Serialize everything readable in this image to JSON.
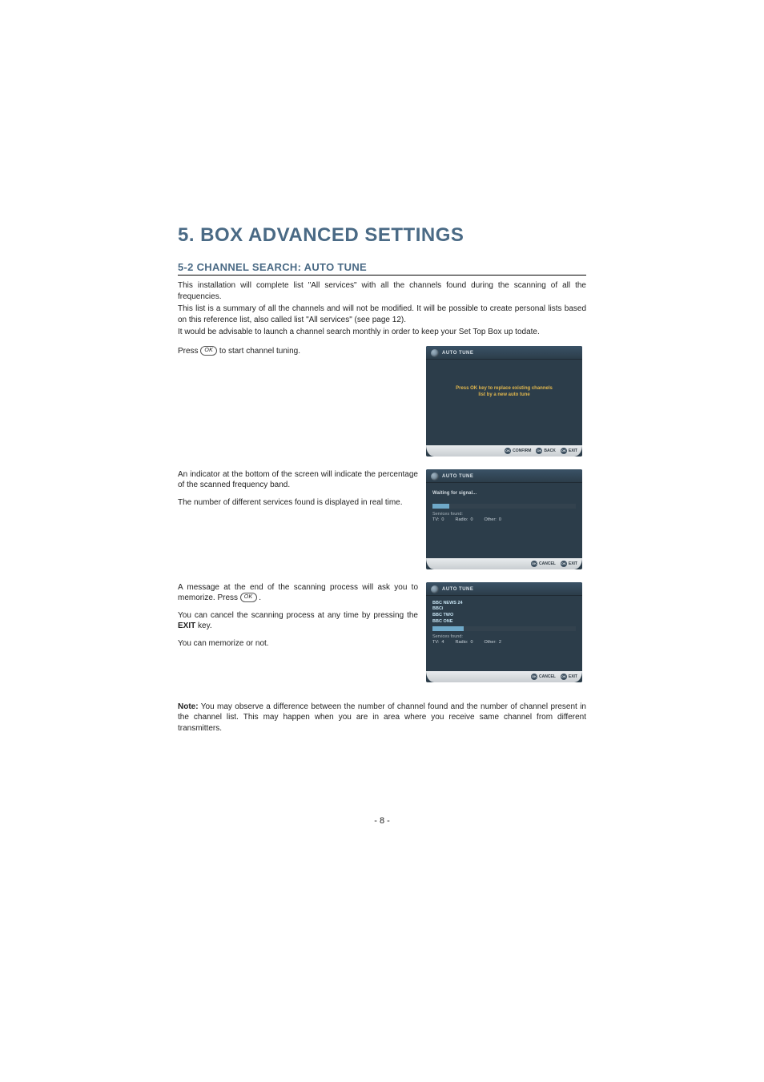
{
  "page": {
    "title": "5. BOX ADVANCED SETTINGS",
    "subsection": "5-2 CHANNEL SEARCH: AUTO TUNE",
    "intro": [
      "This installation will complete list \"All services\" with all the channels found during the scanning of all the frequencies.",
      "This list is a summary of all the channels and will not be modified. It will be possible to create personal lists based on this reference list, also called list \"All services\" (see page 12).",
      "It would be advisable to launch a channel search monthly in order to keep your Set Top Box up todate."
    ],
    "press": {
      "pre": "Press",
      "ok": "OK",
      "post": "to start channel tuning."
    },
    "mid_left": [
      "An indicator at the bottom of the screen will indicate the percentage of the scanned frequency band.",
      "The number of different services found is displayed in real time."
    ],
    "end_left": {
      "p1_pre": "A message at the end of the scanning process will ask you to memorize. Press",
      "p1_ok": "OK",
      "p1_post": ".",
      "p2_pre": "You can cancel the scanning process at any time by pressing the ",
      "p2_bold": "EXIT",
      "p2_post": " key.",
      "p3": "You can memorize or not."
    },
    "note": {
      "label": "Note:",
      "text": " You may observe a difference between the number of channel found and the number of channel present in the channel list. This may happen when you are in area where you receive same channel from different transmitters."
    },
    "page_number": "- 8 -"
  },
  "tv": {
    "header": "AUTO TUNE",
    "screen1": {
      "msg_l1": "Press OK key to replace existing channels",
      "msg_l2": "list by a new auto tune",
      "buttons": [
        "CONFIRM",
        "BACK",
        "EXIT"
      ],
      "round": [
        "OK",
        "OK",
        "OK"
      ]
    },
    "screen2": {
      "waiting": "Waiting for signal...",
      "progress_percent": 12,
      "serv_label": "Services found:",
      "tv_label": "TV:",
      "tv_val": "0",
      "radio_label": "Radio:",
      "radio_val": "0",
      "other_label": "Other:",
      "other_val": "0",
      "buttons": [
        "CANCEL",
        "EXIT"
      ],
      "round": [
        "OK",
        "OK"
      ]
    },
    "screen3": {
      "channels": [
        "BBC NEWS 24",
        "BBCi",
        "BBC TWO",
        "BBC ONE"
      ],
      "progress_percent": 22,
      "serv_label": "Services found:",
      "tv_label": "TV:",
      "tv_val": "4",
      "radio_label": "Radio:",
      "radio_val": "0",
      "other_label": "Other:",
      "other_val": "2",
      "buttons": [
        "CANCEL",
        "EXIT"
      ],
      "round": [
        "OK",
        "OK"
      ]
    }
  }
}
